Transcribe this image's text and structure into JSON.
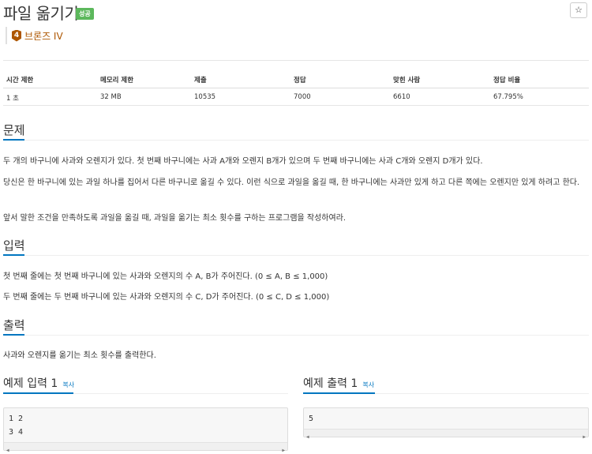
{
  "header": {
    "title": "파일 옮기기",
    "status_badge": "성공",
    "star_icon": "☆",
    "tier_number": "4",
    "tier_label": "브론즈 IV"
  },
  "info_table": {
    "headers": [
      "시간 제한",
      "메모리 제한",
      "제출",
      "정답",
      "맞힌 사람",
      "정답 비율"
    ],
    "values": [
      "1 초",
      "32 MB",
      "10535",
      "7000",
      "6610",
      "67.795%"
    ]
  },
  "problem": {
    "title": "문제",
    "paragraphs": [
      "두 개의 바구니에 사과와 오렌지가 있다. 첫 번째 바구니에는 사과 A개와 오렌지 B개가 있으며 두 번째 바구니에는 사과 C개와 오렌지 D개가 있다.",
      "당신은 한 바구니에 있는 과일 하나를 집어서 다른 바구니로 옮길 수 있다. 이런 식으로 과일을 옮길 때, 한 바구니에는 사과만 있게 하고 다른 쪽에는 오렌지만 있게 하려고 한다.",
      "앞서 말한 조건을 만족하도록 과일을 옮길 때, 과일을 옮기는 최소 횟수를 구하는 프로그램을 작성하여라."
    ]
  },
  "input_section": {
    "title": "입력",
    "paragraphs": [
      "첫 번째 줄에는 첫 번째 바구니에 있는 사과와 오렌지의 수 A, B가 주어진다. (0 ≤ A, B ≤ 1,000)",
      "두 번째 줄에는 두 번째 바구니에 있는 사과와 오렌지의 수 C, D가 주어진다. (0 ≤ C, D ≤ 1,000)"
    ]
  },
  "output_section": {
    "title": "출력",
    "paragraphs": [
      "사과와 오렌지를 옮기는 최소 횟수를 출력한다."
    ]
  },
  "samples": {
    "input_title": "예제 입력 1",
    "output_title": "예제 출력 1",
    "copy_label": "복사",
    "input_lines": [
      "1 2",
      "3 4"
    ],
    "output_lines": [
      "5"
    ]
  },
  "colors": {
    "accent": "#0076c0",
    "success": "#5cb85c",
    "bronze": "#ad5600"
  }
}
